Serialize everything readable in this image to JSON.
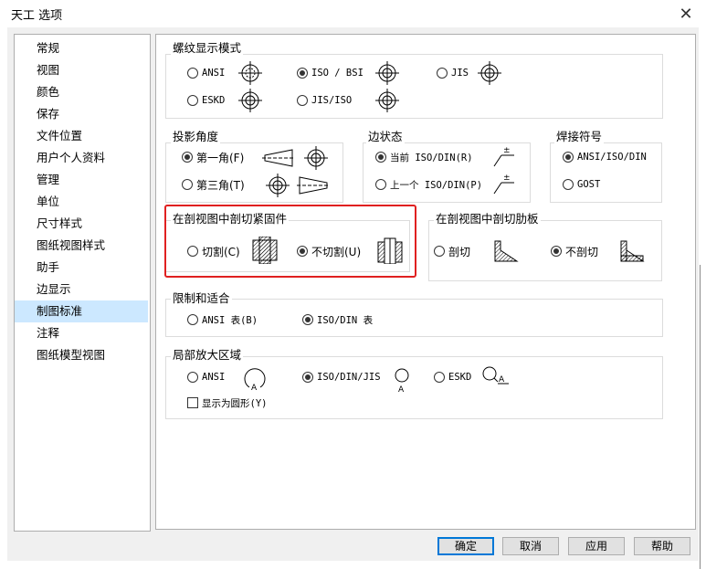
{
  "window": {
    "title": "天工 选项",
    "close_glyph": "✕"
  },
  "sidebar": {
    "items": [
      "常规",
      "视图",
      "颜色",
      "保存",
      "文件位置",
      "用户个人资料",
      "管理",
      "单位",
      "尺寸样式",
      "图纸视图样式",
      "助手",
      "边显示",
      "制图标准",
      "注释",
      "图纸模型视图"
    ],
    "selected": "制图标准"
  },
  "thread": {
    "title": "螺纹显示模式",
    "ansi": "ANSI",
    "iso_bsi": "ISO / BSI",
    "jis": "JIS",
    "eskd": "ESKD",
    "jis_iso": "JIS/ISO",
    "selected": "ISO / BSI"
  },
  "projection": {
    "title": "投影角度",
    "first": "第一角(F)",
    "third": "第三角(T)",
    "selected": "第一角(F)"
  },
  "edge_state": {
    "title": "边状态",
    "current": "当前 ISO/DIN(R)",
    "previous": "上一个 ISO/DIN(P)",
    "selected": "当前 ISO/DIN(R)"
  },
  "weld": {
    "title": "焊接符号",
    "ansi_iso_din": "ANSI/ISO/DIN",
    "gost": "GOST",
    "selected": "ANSI/ISO/DIN"
  },
  "fastener": {
    "title": "在剖视图中剖切紧固件",
    "cut": "切割(C)",
    "nocut": "不切割(U)",
    "selected": "不切割(U)"
  },
  "rib": {
    "title": "在剖视图中剖切肋板",
    "cut": "剖切",
    "nocut": "不剖切",
    "selected": "不剖切"
  },
  "limits": {
    "title": "限制和适合",
    "ansi": "ANSI 表(B)",
    "iso": "ISO/DIN 表",
    "selected": "ISO/DIN 表"
  },
  "detail": {
    "title": "局部放大区域",
    "ansi": "ANSI",
    "iso": "ISO/DIN/JIS",
    "eskd": "ESKD",
    "selected": "ISO/DIN/JIS",
    "label_a": "A",
    "circle_checkbox": "显示为圆形(Y)",
    "circle_checked": false
  },
  "buttons": {
    "ok": "确定",
    "cancel": "取消",
    "apply": "应用",
    "help": "帮助"
  },
  "colors": {
    "selection": "#cce8ff",
    "highlight_box": "#e02020",
    "default_button_border": "#0078d7"
  }
}
